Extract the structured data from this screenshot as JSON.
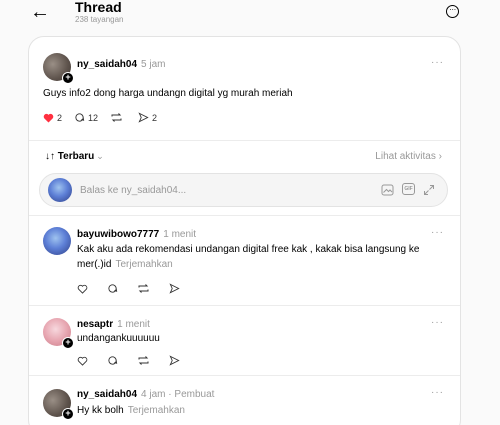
{
  "header": {
    "title": "Thread",
    "views": "238 tayangan",
    "more_icon": "ellipsis-circle-icon"
  },
  "post": {
    "username": "ny_saidah04",
    "time": "5 jam",
    "text": "Guys info2 dong harga undangn digital yg murah meriah",
    "likes": "2",
    "replies": "12",
    "shares": "2",
    "like_color": "#ff3040"
  },
  "sort": {
    "label": "Terbaru",
    "activity_label": "Lihat aktivitas"
  },
  "reply_box": {
    "placeholder": "Balas ke ny_saidah04..."
  },
  "comments": [
    {
      "username": "bayuwibowo7777",
      "time": "1 menit",
      "text_line1": "Kak aku ada rekomendasi undangan digital free kak , kakak bisa langsung ke",
      "text_line2": "mer(.)id",
      "translate": "Terjemahkan"
    },
    {
      "username": "nesaptr",
      "time": "1 menit",
      "text": "undangankuuuuuu"
    },
    {
      "username": "ny_saidah04",
      "time": "4 jam",
      "separator": "·",
      "author_tag": "Pembuat",
      "text": "Hy kk bolh",
      "translate": "Terjemahkan"
    }
  ]
}
